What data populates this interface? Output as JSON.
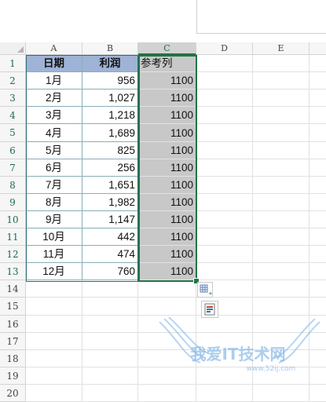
{
  "columns": [
    "A",
    "B",
    "C",
    "D",
    "E"
  ],
  "rows": [
    "1",
    "2",
    "3",
    "4",
    "5",
    "6",
    "7",
    "8",
    "9",
    "10",
    "11",
    "12",
    "13",
    "14",
    "15",
    "16",
    "17",
    "18",
    "19",
    "20"
  ],
  "header": {
    "a": "日期",
    "b": "利润",
    "c": "参考列"
  },
  "data": [
    {
      "month": "1月",
      "profit": "956",
      "ref": "1100"
    },
    {
      "month": "2月",
      "profit": "1,027",
      "ref": "1100"
    },
    {
      "month": "3月",
      "profit": "1,218",
      "ref": "1100"
    },
    {
      "month": "4月",
      "profit": "1,689",
      "ref": "1100"
    },
    {
      "month": "5月",
      "profit": "825",
      "ref": "1100"
    },
    {
      "month": "6月",
      "profit": "256",
      "ref": "1100"
    },
    {
      "month": "7月",
      "profit": "1,651",
      "ref": "1100"
    },
    {
      "month": "8月",
      "profit": "1,982",
      "ref": "1100"
    },
    {
      "month": "9月",
      "profit": "1,147",
      "ref": "1100"
    },
    {
      "month": "10月",
      "profit": "442",
      "ref": "1100"
    },
    {
      "month": "11月",
      "profit": "474",
      "ref": "1100"
    },
    {
      "month": "12月",
      "profit": "760",
      "ref": "1100"
    }
  ],
  "selected_column": "C",
  "icons": {
    "paste_options": "paste-options-icon",
    "quick_analysis": "quick-analysis-icon"
  },
  "watermark": {
    "title": "我爱IT技术网",
    "url": "www.52ij.com"
  },
  "colors": {
    "accent": "#217346",
    "header_fill": "#9fb3d6",
    "selection_fill": "#c8c8c8"
  }
}
